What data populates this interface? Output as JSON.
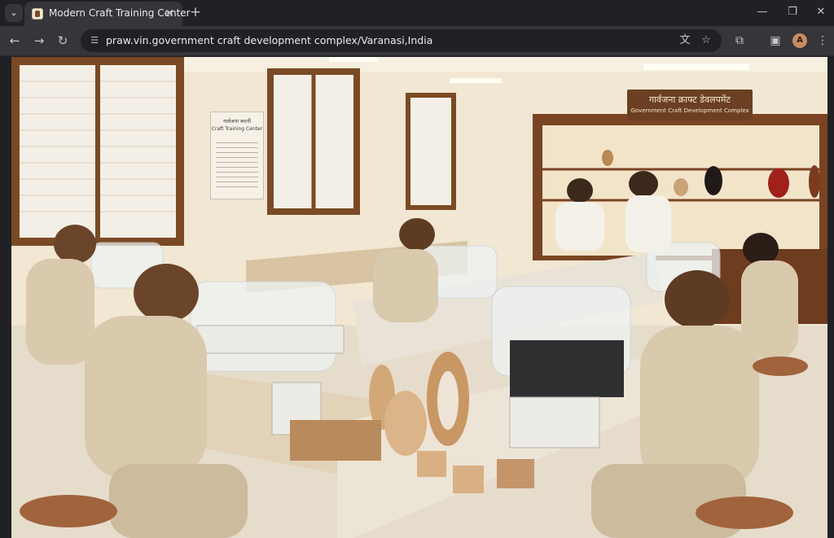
{
  "browser": {
    "tab": {
      "title": "Modern Craft Training Center"
    },
    "address_bar": {
      "url": "praw.vin.government craft development complex/Varanasi,India"
    },
    "profile_initial": "A"
  },
  "page": {
    "sign": {
      "hindi": "गार्वजना क्राफ्ट डेवलपमेंट",
      "english": "Government Craft Development Complex"
    },
    "notice": {
      "hindi": "गार्वजना करनी",
      "english": "Craft Training Center"
    }
  },
  "icons": {
    "tab_search": "chevron-down-icon",
    "favicon": "craft-center-favicon",
    "close": "close-icon",
    "new_tab": "plus-icon",
    "minimize": "minimize-icon",
    "restore": "restore-icon",
    "window_close": "window-close-icon",
    "back": "back-arrow-icon",
    "forward": "forward-arrow-icon",
    "reload": "reload-icon",
    "site_settings": "tune-icon",
    "translate": "translate-icon",
    "bookmark": "star-icon",
    "extensions": "puzzle-icon",
    "side_panel": "side-panel-icon",
    "menu": "kebab-menu-icon"
  }
}
